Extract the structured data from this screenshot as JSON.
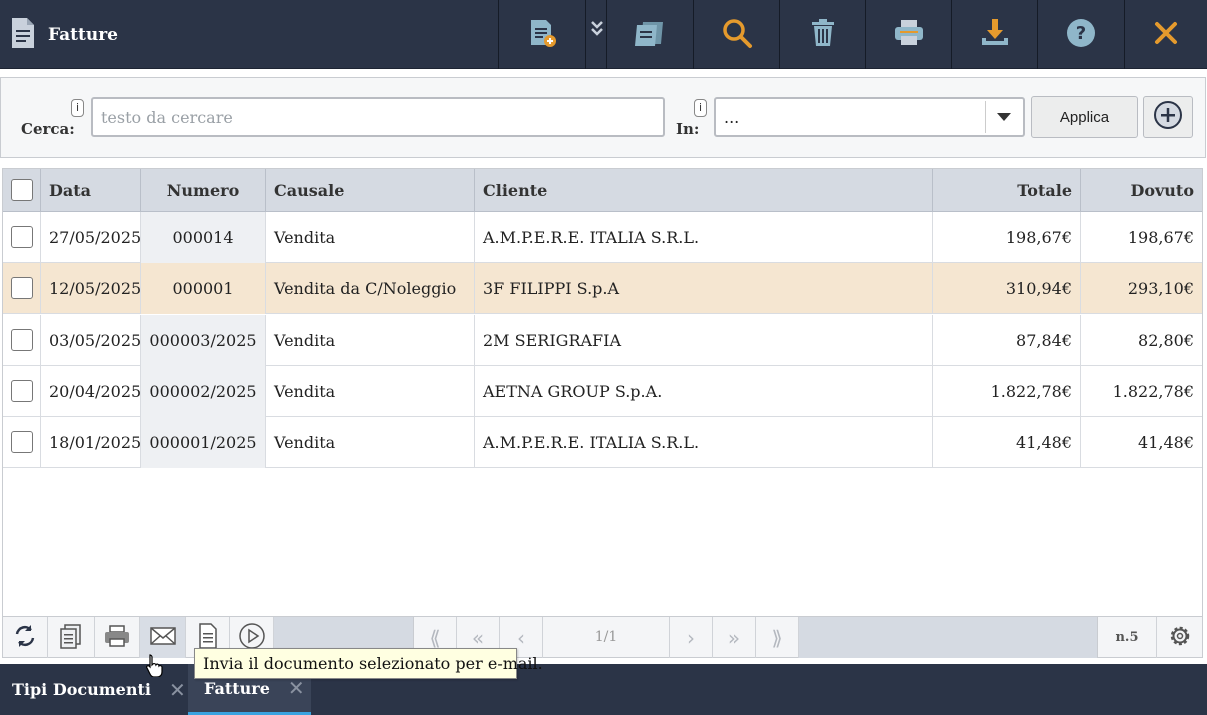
{
  "header": {
    "title": "Fatture",
    "title_icon": "document-icon",
    "toolbar": [
      {
        "name": "new-document-icon",
        "color": "#8fb6c9"
      },
      {
        "name": "expand-chevrons-icon",
        "color": "#8fb6c9"
      },
      {
        "name": "duplicate-documents-icon",
        "color": "#8fb6c9"
      },
      {
        "name": "search-icon",
        "color": "#e59a2d"
      },
      {
        "name": "trash-icon",
        "color": "#8fb6c9"
      },
      {
        "name": "print-icon",
        "color": "#8fb6c9"
      },
      {
        "name": "download-icon",
        "color": "#8fb6c9"
      },
      {
        "name": "help-icon",
        "color": "#8fb6c9"
      },
      {
        "name": "close-icon",
        "color": "#e59a2d"
      }
    ]
  },
  "search": {
    "cerca_label": "Cerca:",
    "info": "i",
    "placeholder": "testo da cercare",
    "value": "",
    "in_label": "In:",
    "in_value": "...",
    "apply_label": "Applica"
  },
  "table": {
    "columns": [
      "Data",
      "Numero",
      "Causale",
      "Cliente",
      "Totale",
      "Dovuto"
    ],
    "rows": [
      {
        "data": "27/05/2025",
        "numero": "000014",
        "causale": "Vendita",
        "cliente": "A.M.P.E.R.E. ITALIA S.R.L.",
        "totale": "198,67€",
        "dovuto": "198,67€",
        "selected": false
      },
      {
        "data": "12/05/2025",
        "numero": "000001",
        "causale": "Vendita da C/Noleggio",
        "cliente": "3F FILIPPI S.p.A",
        "totale": "310,94€",
        "dovuto": "293,10€",
        "selected": true
      },
      {
        "data": "03/05/2025",
        "numero": "000003/2025",
        "causale": "Vendita",
        "cliente": "2M SERIGRAFIA",
        "totale": "87,84€",
        "dovuto": "82,80€",
        "selected": false
      },
      {
        "data": "20/04/2025",
        "numero": "000002/2025",
        "causale": "Vendita",
        "cliente": "AETNA GROUP S.p.A.",
        "totale": "1.822,78€",
        "dovuto": "1.822,78€",
        "selected": false
      },
      {
        "data": "18/01/2025",
        "numero": "000001/2025",
        "causale": "Vendita",
        "cliente": "A.M.P.E.R.E. ITALIA S.R.L.",
        "totale": "41,48€",
        "dovuto": "41,48€",
        "selected": false
      }
    ],
    "selected_row_color": "#f5e6d1"
  },
  "pager": {
    "page": "1/1",
    "count": "n.5",
    "first": "⟪",
    "prev_fast": "«",
    "prev": "‹",
    "next": "›",
    "next_fast": "»",
    "last": "⟫"
  },
  "tooltip": {
    "text": "Invia il documento selezionato per e-mail."
  },
  "tabs": [
    {
      "label": "Tipi Documenti",
      "close": "✕",
      "active": false
    },
    {
      "label": "Fatture",
      "close": "✕",
      "active": true
    }
  ]
}
